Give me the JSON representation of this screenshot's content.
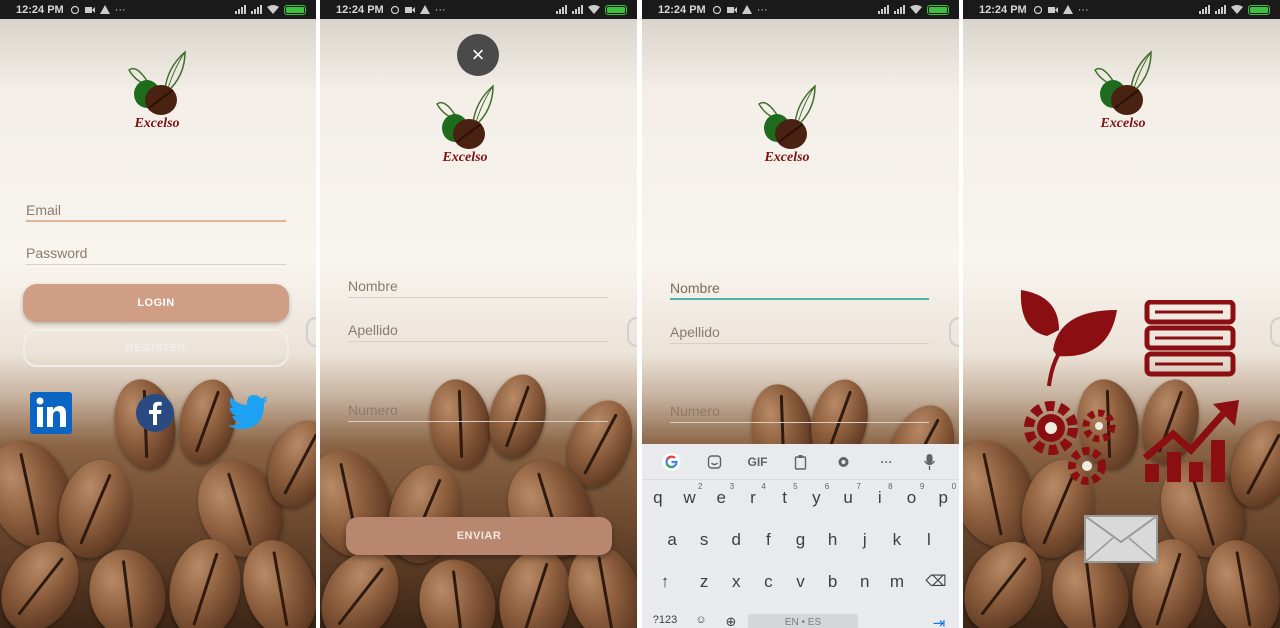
{
  "status_bar": {
    "time": "12:24 PM",
    "more": "···"
  },
  "brand": {
    "name": "Excelso"
  },
  "login_screen": {
    "email_placeholder": "Email",
    "password_placeholder": "Password",
    "login_label": "LOGIN",
    "register_label": "REGISTER",
    "social": [
      "linkedin-icon",
      "facebook-icon",
      "twitter-icon"
    ]
  },
  "register_screen": {
    "close_icon": "×",
    "nombre_placeholder": "Nombre",
    "apellido_placeholder": "Apellido",
    "numero_placeholder": "Numero",
    "enviar_label": "ENVIAR"
  },
  "keyboard_screen": {
    "nombre_value": "Nombre",
    "apellido_placeholder": "Apellido",
    "numero_placeholder": "Numero",
    "toolbar": {
      "gif": "GIF",
      "more": "···"
    },
    "row1": [
      [
        "q",
        ""
      ],
      [
        "w",
        "2"
      ],
      [
        "e",
        "3"
      ],
      [
        "r",
        "4"
      ],
      [
        "t",
        "5"
      ],
      [
        "y",
        "6"
      ],
      [
        "u",
        "7"
      ],
      [
        "i",
        "8"
      ],
      [
        "o",
        "9"
      ],
      [
        "p",
        "0"
      ]
    ],
    "row2": [
      "a",
      "s",
      "d",
      "f",
      "g",
      "h",
      "j",
      "k",
      "l"
    ],
    "row3": [
      "z",
      "x",
      "c",
      "v",
      "b",
      "n",
      "m"
    ],
    "sym_key": "?123",
    "space_label": "EN • ES"
  },
  "menu_screen": {
    "icons": [
      "leaf-icon",
      "books-icon",
      "gears-icon",
      "growth-chart-icon",
      "mail-icon"
    ],
    "icon_color": "#8b0f12"
  },
  "colors": {
    "accent": "#cf9e85",
    "brand_red": "#7b1214",
    "focus": "#4fb0a8"
  }
}
